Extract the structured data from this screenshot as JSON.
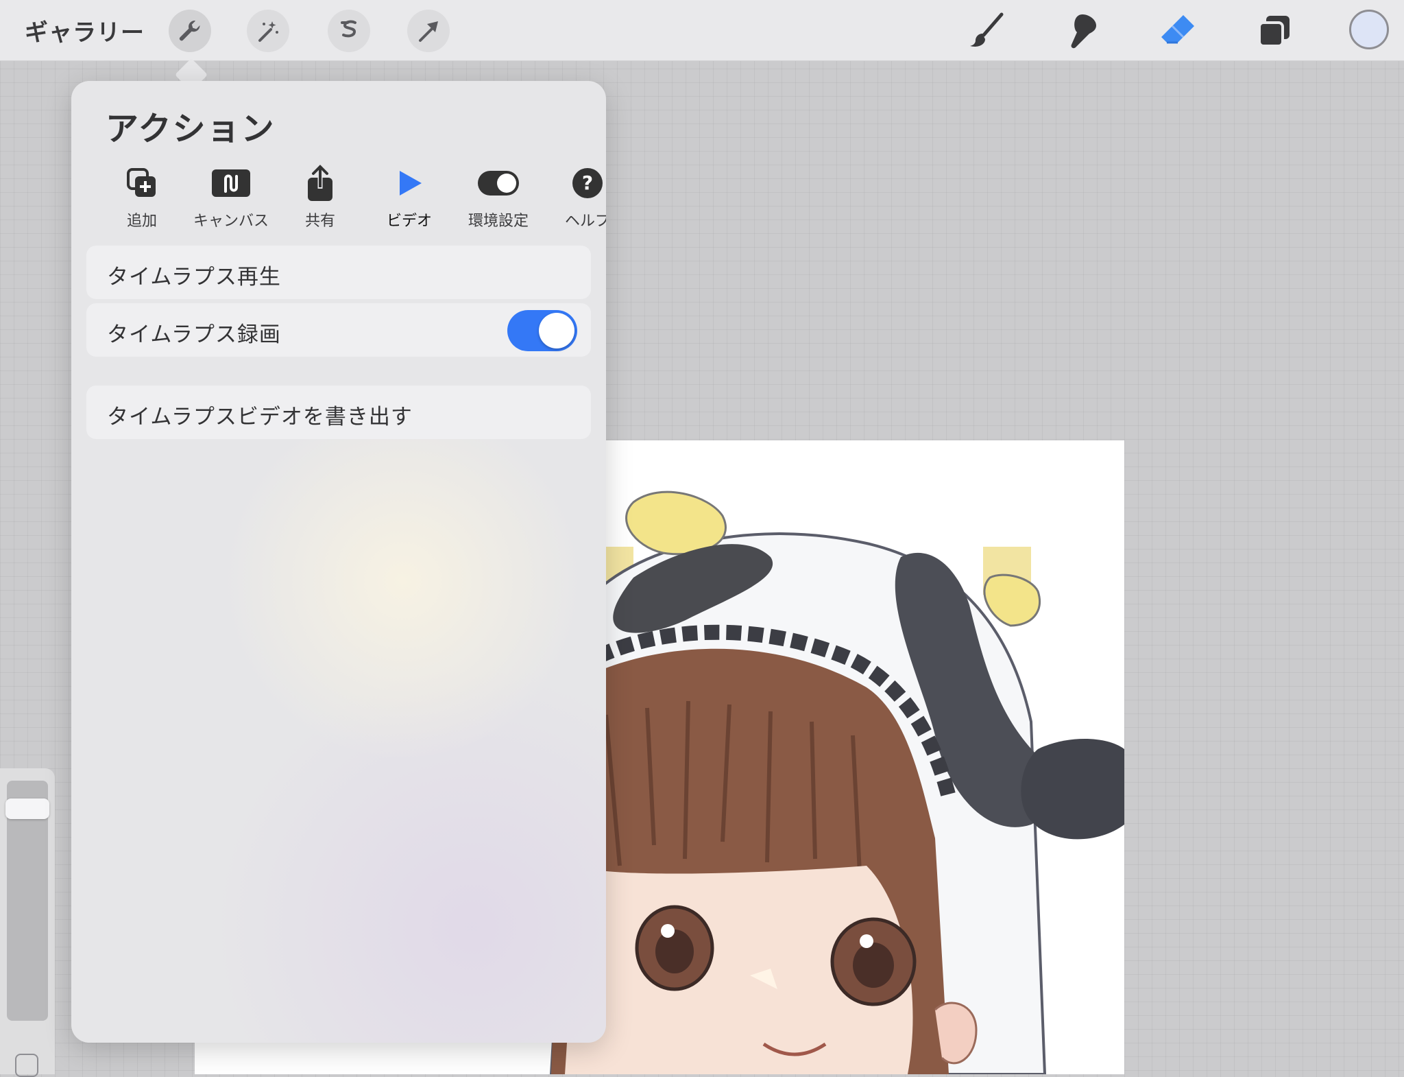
{
  "toolbar": {
    "gallery_label": "ギャラリー",
    "left_tools": [
      {
        "icon": "wrench-icon",
        "active": true
      },
      {
        "icon": "magic-wand-icon",
        "active": false
      },
      {
        "icon": "selection-icon",
        "active": false
      },
      {
        "icon": "transform-arrow-icon",
        "active": false
      }
    ],
    "right_tools": [
      "brush-icon",
      "smudge-icon",
      "eraser-icon",
      "layers-icon"
    ],
    "current_color": "#dde4f6",
    "eraser_active_color": "#3d8bf3"
  },
  "actions_popover": {
    "title": "アクション",
    "tabs": [
      {
        "label": "追加",
        "icon": "add-icon"
      },
      {
        "label": "キャンバス",
        "icon": "canvas-icon"
      },
      {
        "label": "共有",
        "icon": "share-icon"
      },
      {
        "label": "ビデオ",
        "icon": "play-icon",
        "active": true
      },
      {
        "label": "環境設定",
        "icon": "toggle-prefs-icon"
      },
      {
        "label": "ヘルプ",
        "icon": "help-icon"
      }
    ],
    "rows": {
      "timelapse_replay": "タイムラプス再生",
      "timelapse_record": "タイムラプス録画",
      "timelapse_record_on": true,
      "timelapse_export": "タイムラプスビデオを書き出す"
    },
    "accent_color": "#3478f6"
  },
  "sidebar": {
    "brush_size_level": 0.08
  }
}
